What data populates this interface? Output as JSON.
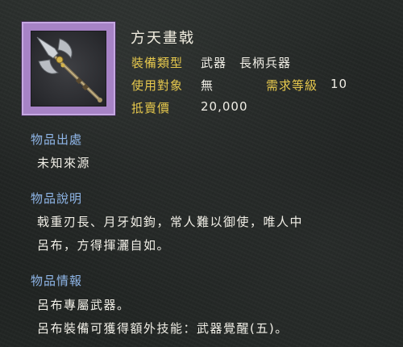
{
  "item": {
    "name": "方天畫戟",
    "icon": "halberd-icon",
    "frame_color": "#a783c6"
  },
  "stats": {
    "type_label": "裝備類型",
    "type_value": "武器　長柄兵器",
    "target_label": "使用對象",
    "target_value": "無",
    "level_label": "需求等級",
    "level_value": "10",
    "price_label": "抵賣價",
    "price_value": "20,000"
  },
  "sections": {
    "origin": {
      "title": "物品出處",
      "lines": [
        "未知來源"
      ]
    },
    "description": {
      "title": "物品說明",
      "lines": [
        "戟重刃長、月牙如鉤，常人難以御使，唯人中",
        "呂布，方得揮灑自如。"
      ]
    },
    "info": {
      "title": "物品情報",
      "lines": [
        "呂布專屬武器。",
        "呂布裝備可獲得額外技能：武器覺醒(五)。"
      ]
    }
  },
  "colors": {
    "label_gold": "#e6c84d",
    "section_blue": "#8fb6e8",
    "text_white": "#f0eee6"
  }
}
